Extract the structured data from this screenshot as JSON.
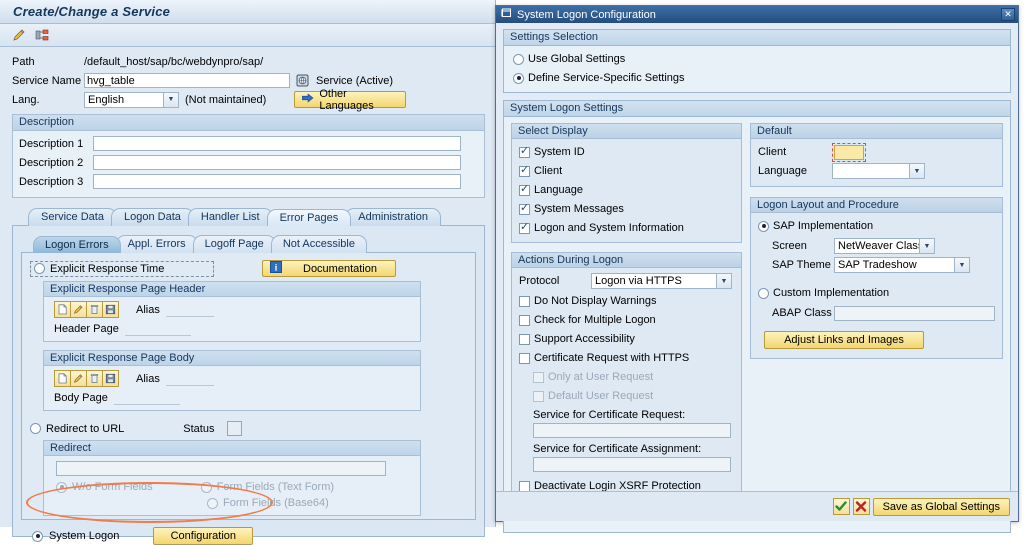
{
  "window": {
    "title": "Create/Change a Service",
    "toolbar_icons": [
      "pencil-icon",
      "hierarchy-icon"
    ]
  },
  "service_form": {
    "path_label": "Path",
    "path_value": "/default_host/sap/bc/webdynpro/sap/",
    "service_name_label": "Service Name",
    "service_name_value": "hvg_table",
    "service_status_icon": "globe-icon",
    "service_status": "Service (Active)",
    "lang_label": "Lang.",
    "lang_value": "English",
    "lang_note": "(Not maintained)",
    "other_languages_button": "Other Languages",
    "other_languages_icon": "arrow-right-icon"
  },
  "description_group": {
    "header": "Description",
    "rows": [
      {
        "label": "Description 1",
        "value": ""
      },
      {
        "label": "Description 2",
        "value": ""
      },
      {
        "label": "Description 3",
        "value": ""
      }
    ]
  },
  "main_tabs": [
    {
      "label": "Service Data",
      "selected": false
    },
    {
      "label": "Logon Data",
      "selected": false
    },
    {
      "label": "Handler List",
      "selected": false
    },
    {
      "label": "Error Pages",
      "selected": true
    },
    {
      "label": "Administration",
      "selected": false
    }
  ],
  "sub_tabs": [
    {
      "label": "Logon Errors",
      "selected": true
    },
    {
      "label": "Appl. Errors",
      "selected": false
    },
    {
      "label": "Logoff Page",
      "selected": false
    },
    {
      "label": "Not Accessible",
      "selected": false
    }
  ],
  "error_pages": {
    "explicit_response_time": "Explicit Response Time",
    "explicit_response_time_selected": false,
    "documentation_button": "Documentation",
    "documentation_icon": "info-icon",
    "header_group": {
      "header": "Explicit Response Page Header",
      "alias_label": "Alias",
      "alias_value": "",
      "page_label": "Header Page",
      "page_value": "",
      "icons": [
        "new-page-icon",
        "edit-pencil-icon",
        "delete-trash-icon",
        "save-disk-icon"
      ]
    },
    "body_group": {
      "header": "Explicit Response Page Body",
      "alias_label": "Alias",
      "alias_value": "",
      "page_label": "Body Page",
      "page_value": "",
      "icons": [
        "new-page-icon",
        "edit-pencil-icon",
        "delete-trash-icon",
        "save-disk-icon"
      ]
    },
    "redirect_to_url": "Redirect to URL",
    "redirect_selected": false,
    "status_label": "Status",
    "status_value": "",
    "redirect_group_header": "Redirect",
    "redirect_url_value": "",
    "redirect_options": [
      {
        "label": "W/o Form Fields",
        "selected": true,
        "disabled": true
      },
      {
        "label": "Form Fields (Text Form)",
        "selected": false,
        "disabled": true
      },
      {
        "label": "Form Fields (Base64)",
        "selected": false,
        "disabled": true
      }
    ],
    "system_logon": "System Logon",
    "system_logon_selected": true,
    "configuration_button": "Configuration"
  },
  "dialog": {
    "title": "System Logon Configuration",
    "title_icon": "window-icon",
    "close_icon": "close-icon",
    "settings_selection": {
      "header": "Settings Selection",
      "options": [
        {
          "label": "Use Global Settings",
          "selected": false
        },
        {
          "label": "Define Service-Specific Settings",
          "selected": true
        }
      ]
    },
    "system_logon_settings": {
      "header": "System Logon Settings",
      "select_display": {
        "header": "Select Display",
        "items": [
          {
            "label": "System ID",
            "checked": true
          },
          {
            "label": "Client",
            "checked": true
          },
          {
            "label": "Language",
            "checked": true
          },
          {
            "label": "System Messages",
            "checked": true
          },
          {
            "label": "Logon and System Information",
            "checked": true
          }
        ]
      },
      "actions_during_logon": {
        "header": "Actions During Logon",
        "protocol_label": "Protocol",
        "protocol_value": "Logon via HTTPS",
        "items": [
          {
            "label": "Do Not Display Warnings",
            "checked": false,
            "disabled": false
          },
          {
            "label": "Check for Multiple Logon",
            "checked": false,
            "disabled": false
          },
          {
            "label": "Support Accessibility",
            "checked": false,
            "disabled": false
          },
          {
            "label": "Certificate Request with HTTPS",
            "checked": false,
            "disabled": false
          },
          {
            "label": "Only at User Request",
            "checked": false,
            "disabled": true
          },
          {
            "label": "Default User Request",
            "checked": false,
            "disabled": true
          }
        ],
        "cert_request_label": "Service for Certificate Request:",
        "cert_request_value": "",
        "cert_assignment_label": "Service for Certificate Assignment:",
        "cert_assignment_value": "",
        "xsrf_label": "Deactivate Login XSRF Protection",
        "xsrf_checked": false
      },
      "default": {
        "header": "Default",
        "client_label": "Client",
        "client_value": "",
        "language_label": "Language",
        "language_value": ""
      },
      "logon_layout": {
        "header": "Logon Layout and Procedure",
        "sap_implementation": "SAP Implementation",
        "sap_implementation_selected": true,
        "screen_label": "Screen",
        "screen_value": "NetWeaver Classic",
        "theme_label": "SAP Theme",
        "theme_value": "SAP Tradeshow",
        "custom_implementation": "Custom Implementation",
        "custom_implementation_selected": false,
        "abap_class_label": "ABAP Class",
        "abap_class_value": "",
        "adjust_button": "Adjust Links and Images"
      }
    },
    "footer": {
      "ok_icon": "checkmark-icon",
      "cancel_icon": "cross-icon",
      "save_global_button": "Save as Global Settings"
    }
  },
  "colors": {
    "accent_blue": "#254e7f",
    "panel_blue": "#dfe9f4",
    "button_yellow": "#f3d670",
    "highlight_orange": "#ef7c4a",
    "focus_red": "#e24b35"
  }
}
